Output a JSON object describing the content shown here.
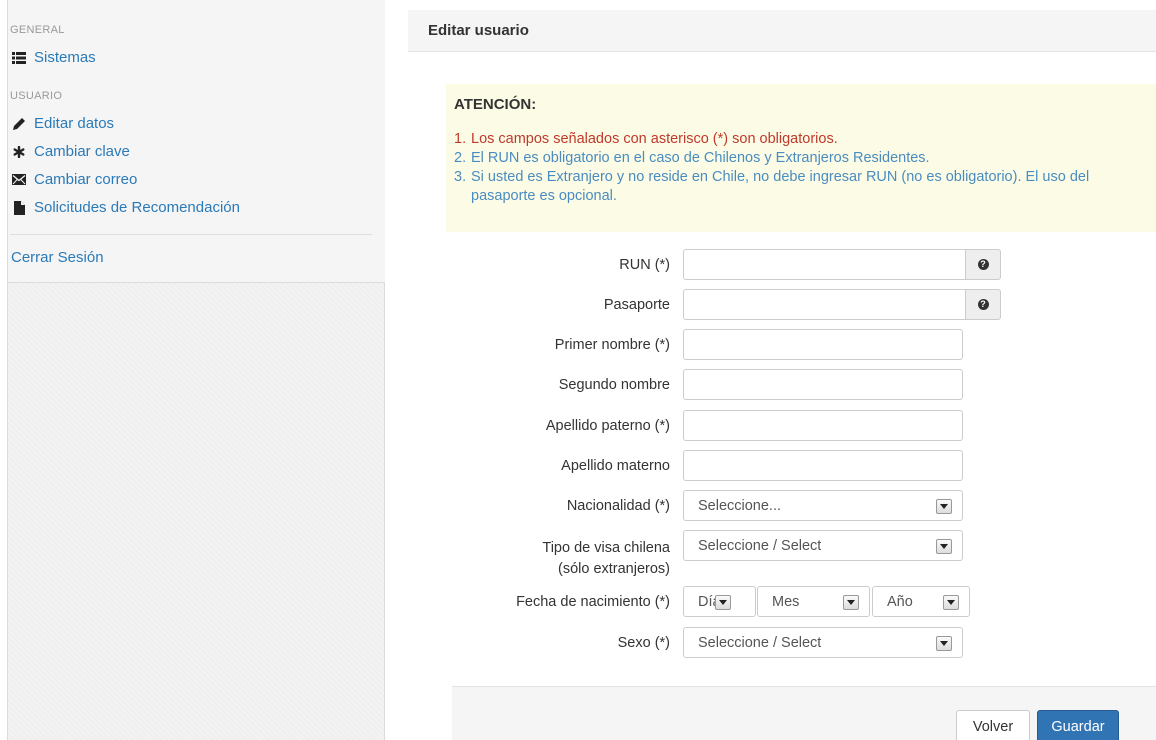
{
  "sidebar": {
    "general_header": "GENERAL",
    "general_items": [
      {
        "label": "Sistemas",
        "icon": "list-icon"
      }
    ],
    "user_header": "USUARIO",
    "user_items": [
      {
        "label": "Editar datos",
        "icon": "pencil-icon"
      },
      {
        "label": "Cambiar clave",
        "icon": "asterisk-icon"
      },
      {
        "label": "Cambiar correo",
        "icon": "envelope-icon"
      },
      {
        "label": "Solicitudes de Recomendación",
        "icon": "file-icon"
      }
    ],
    "logout": "Cerrar Sesión"
  },
  "panel": {
    "title": "Editar usuario"
  },
  "alert": {
    "title": "ATENCIÓN:",
    "items": [
      {
        "num": "1.",
        "text": "Los campos señalados con asterisco (*) son obligatorios."
      },
      {
        "num": "2.",
        "text": "El RUN es obligatorio en el caso de Chilenos y Extranjeros Residentes."
      },
      {
        "num": "3.",
        "text": "Si usted es Extranjero y no reside en Chile, no debe ingresar RUN (no es obligatorio). El uso del pasaporte es opcional."
      }
    ]
  },
  "form": {
    "run_label": "RUN (*)",
    "run_value": "",
    "pasaporte_label": "Pasaporte",
    "pasaporte_value": "",
    "primer_nombre_label": "Primer nombre (*)",
    "segundo_nombre_label": "Segundo nombre",
    "apellido_paterno_label": "Apellido paterno (*)",
    "apellido_materno_label": "Apellido materno",
    "nacionalidad_label": "Nacionalidad (*)",
    "nacionalidad_value": "Seleccione...",
    "visa_label_1": "Tipo de visa chilena",
    "visa_label_2": "(sólo extranjeros)",
    "visa_value": "Seleccione / Select",
    "fecha_label": "Fecha de nacimiento (*)",
    "dia_value": "Día",
    "mes_value": "Mes",
    "anio_value": "Año",
    "sexo_label": "Sexo (*)",
    "sexo_value": "Seleccione / Select",
    "help_glyph": "?"
  },
  "footer": {
    "back_label": "Volver",
    "save_label": "Guardar"
  },
  "colors": {
    "link": "#2a7ab8",
    "alert_bg": "#fcfce6",
    "error_text": "#c0392b",
    "info_text": "#4a8cbf",
    "primary_button": "#3174b4"
  }
}
